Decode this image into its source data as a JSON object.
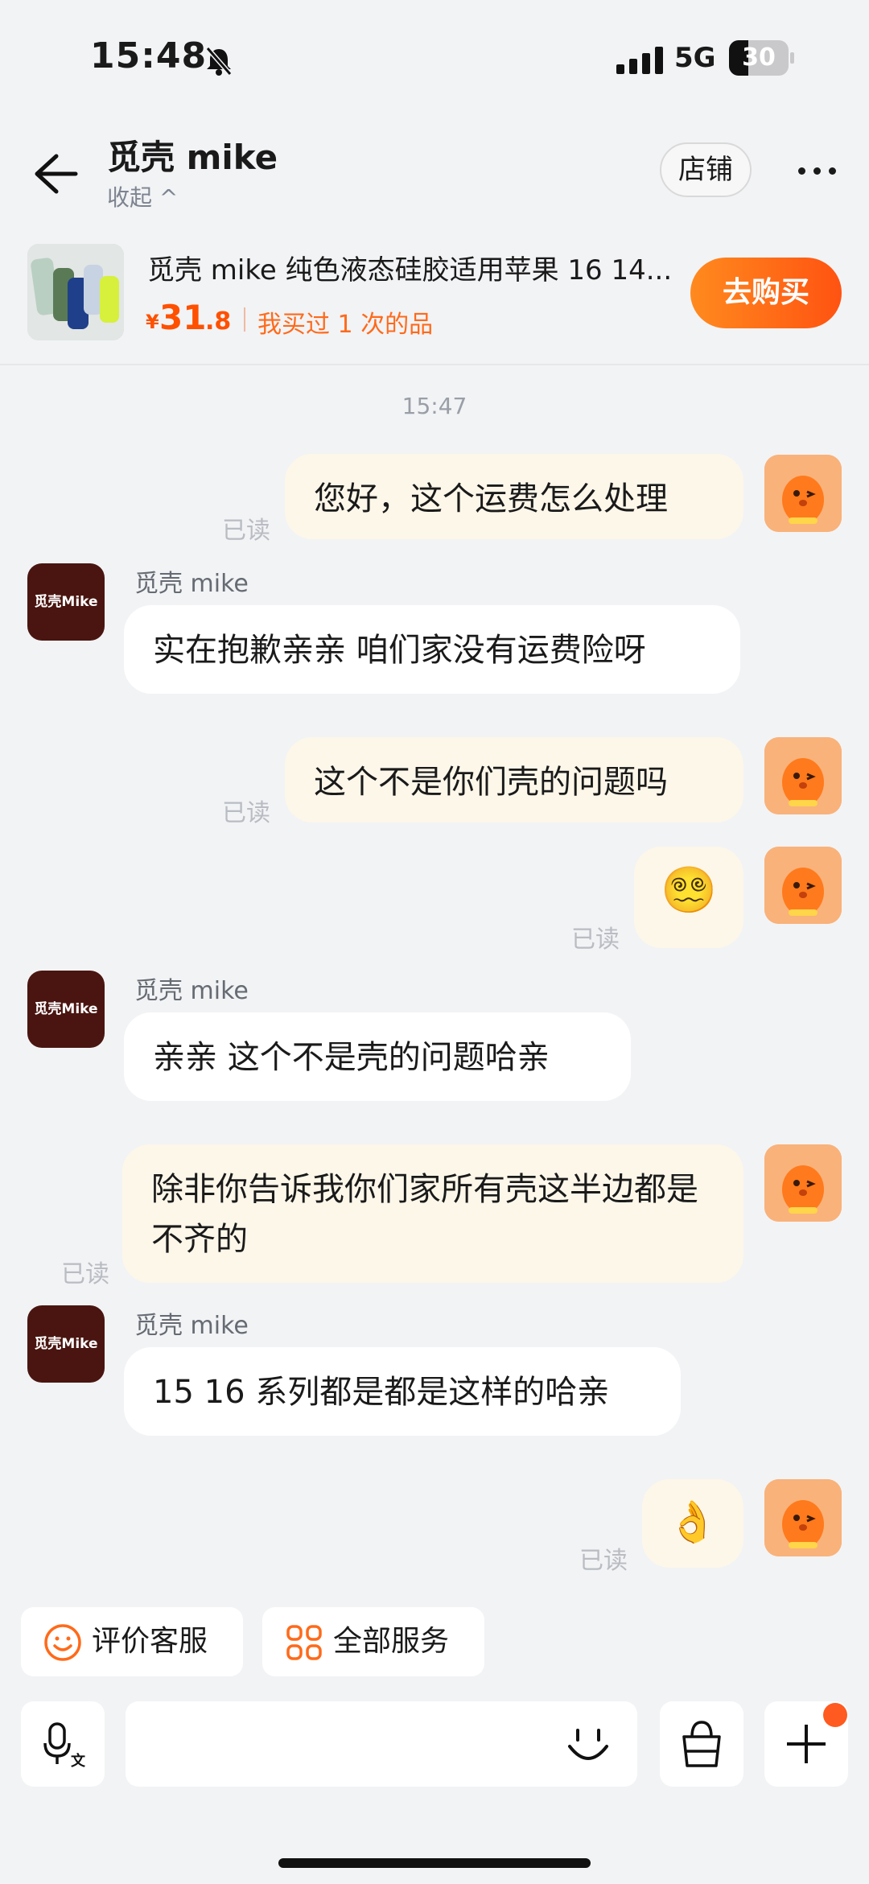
{
  "status_bar": {
    "time": "15:48",
    "network": "5G",
    "battery": "30"
  },
  "header": {
    "title": "觅壳 mike",
    "collapse_label": "收起 ^",
    "store_label": "店铺"
  },
  "product": {
    "title": "觅壳 mike 纯色液态硅胶适用苹果 16 14...",
    "currency": "¥",
    "price_int": "31",
    "price_dec": ".8",
    "bought_text": "我买过 1 次的品",
    "buy_label": "去购买"
  },
  "chat": {
    "timestamp": "15:47",
    "read_label": "已读",
    "shop_name": "觅壳 mike",
    "shop_avatar_text": "觅壳Mike",
    "messages": [
      {
        "from": "me",
        "text": "您好，这个运费怎么处理"
      },
      {
        "from": "shop",
        "text": "实在抱歉亲亲 咱们家没有运费险呀"
      },
      {
        "from": "me",
        "text": "这个不是你们壳的问题吗"
      },
      {
        "from": "me",
        "text": "😵‍💫"
      },
      {
        "from": "shop",
        "text": "亲亲 这个不是壳的问题哈亲"
      },
      {
        "from": "me",
        "text": "除非你告诉我你们家所有壳这半边都是不齐的"
      },
      {
        "from": "shop",
        "text": "15 16 系列都是都是这样的哈亲"
      },
      {
        "from": "me",
        "text": "👌"
      }
    ]
  },
  "quick_actions": [
    {
      "label": "评价客服",
      "icon": "smile-icon"
    },
    {
      "label": "全部服务",
      "icon": "grid-icon"
    }
  ],
  "input_bar": {
    "voice_icon": "mic-translate-icon",
    "emoji_icon": "emoji-icon",
    "bag_icon": "shopping-bag-icon",
    "plus_icon": "plus-icon"
  },
  "colors": {
    "accent": "#ff5000",
    "my_bubble": "#fdf7ea",
    "shop_avatar": "#4a1510",
    "background": "#f2f3f5"
  }
}
